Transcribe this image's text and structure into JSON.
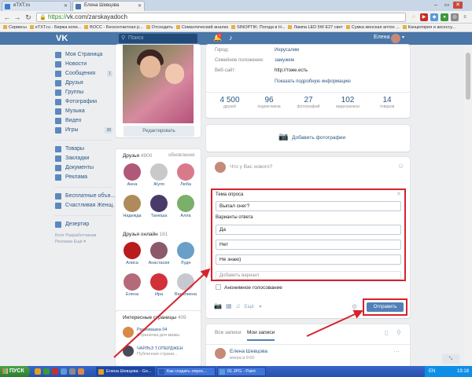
{
  "browser": {
    "tabs": [
      {
        "title": "eTXT.ru",
        "color": "#3a7bd5"
      },
      {
        "title": "Елена Шевцова",
        "color": "#4a76a8"
      }
    ],
    "url_scheme": "https://",
    "url_rest": "vk.com/zarskayadoch",
    "bookmarks": [
      "Сервисы",
      "eTXT.ru - Биржа копи...",
      "BOCC - Бесконтактная р...",
      "Отсоедить",
      "Семантический анализ",
      "SINOPTIK: Погода в Н...",
      "Лампа LED 5W E27 свет",
      "Сумка женская аптон ...",
      "Канцелярия и аксессу..."
    ]
  },
  "vk": {
    "logo": "VK",
    "search_placeholder": "Поиск",
    "notif_count": "1",
    "user_name": "Елена"
  },
  "nav": [
    {
      "label": "Моя Страница",
      "count": "",
      "color": "#5b88bd"
    },
    {
      "label": "Новости",
      "count": "",
      "color": "#5b88bd"
    },
    {
      "label": "Сообщения",
      "count": "1",
      "color": "#5b88bd"
    },
    {
      "label": "Друзья",
      "count": "",
      "color": "#5b88bd"
    },
    {
      "label": "Группы",
      "count": "",
      "color": "#5b88bd"
    },
    {
      "label": "Фотографии",
      "count": "",
      "color": "#5b88bd"
    },
    {
      "label": "Музыка",
      "count": "",
      "color": "#5b88bd"
    },
    {
      "label": "Видео",
      "count": "",
      "color": "#5b88bd"
    },
    {
      "label": "Игры",
      "count": "38",
      "color": "#5b88bd"
    }
  ],
  "nav2": [
    {
      "label": "Товары",
      "count": ""
    },
    {
      "label": "Закладки",
      "count": ""
    },
    {
      "label": "Документы",
      "count": ""
    },
    {
      "label": "Реклама",
      "count": ""
    }
  ],
  "nav3": [
    {
      "label": "Бесплатные объя...",
      "count": ""
    },
    {
      "label": "Счастливая Женщ...",
      "count": ""
    }
  ],
  "nav4": [
    {
      "label": "Дезертир",
      "count": ""
    }
  ],
  "footer": {
    "line1": "Блог   Разработчикам",
    "line2": "Реклама   Ещё ▾"
  },
  "profile": {
    "edit_label": "Редактировать",
    "info": [
      {
        "k": "Город:",
        "v": "Иерусалим",
        "plain": false
      },
      {
        "k": "Семейное положение:",
        "v": "замужем",
        "plain": false
      },
      {
        "k": "Веб-сайт:",
        "v": "http://тоже.есть",
        "plain": true
      }
    ],
    "more_info": "Показать подробную информацию",
    "counters": [
      {
        "num": "4 500",
        "lbl": "друзей"
      },
      {
        "num": "96",
        "lbl": "подписчиков"
      },
      {
        "num": "27",
        "lbl": "фотографий"
      },
      {
        "num": "102",
        "lbl": "видеозаписи"
      },
      {
        "num": "14",
        "lbl": "товаров"
      }
    ],
    "add_photo": "Добавить фотографии"
  },
  "friends": {
    "title": "Друзья",
    "count": "4900",
    "link": "обновления",
    "list": [
      {
        "name": "Анна",
        "color": "#b0577a"
      },
      {
        "name": "Жуля",
        "color": "#c9c9c9"
      },
      {
        "name": "Люба",
        "color": "#d97a8a"
      },
      {
        "name": "Надежда",
        "color": "#b08a5a"
      },
      {
        "name": "Танюша",
        "color": "#4a3a6a"
      },
      {
        "name": "Алла",
        "color": "#7ab06a"
      }
    ],
    "online_title": "Друзья онлайн",
    "online_count": "181",
    "online": [
      {
        "name": "Алиса",
        "color": "#b81c1c"
      },
      {
        "name": "Анастасия",
        "color": "#8a5a6a"
      },
      {
        "name": "Лудя",
        "color": "#6aa0c8"
      },
      {
        "name": "Елена",
        "color": "#b56a7a"
      },
      {
        "name": "Ира",
        "color": "#d2303a"
      },
      {
        "name": "Василиена",
        "color": "#c8c8d0"
      }
    ]
  },
  "interest": {
    "title": "Интересные страницы",
    "count": "409",
    "pages": [
      {
        "title": "Развевашка 04",
        "sub": "Страничка для мамы",
        "color": "#d88a4a"
      },
      {
        "title": "ЧАРЛЬЗ Т.ОПЕРДЖЕН",
        "sub": "Публичная страни...",
        "color": "#4a4a5a"
      }
    ]
  },
  "poster": {
    "placeholder": "Что у Вас нового?"
  },
  "poll": {
    "topic_label": "Тема опроса",
    "topic_value": "Выпал снег?",
    "answers_label": "Варианты ответа",
    "answers": [
      "Да",
      "Нет",
      "Не знаю)"
    ],
    "add_option": "Добавить вариант",
    "anonymous": "Анонимное голосование",
    "more": "Ещё",
    "send": "Отправить"
  },
  "wall": {
    "tab_all": "Все записи",
    "tab_mine": "Мои записи",
    "post_name": "Елена Шевцова",
    "post_time": "вчера в 9:00"
  },
  "zoom": "⤡",
  "taskbar": {
    "start": "ПУСК",
    "tasks": [
      {
        "title": "Елена Шевцова - Go...",
        "color": "#e0a020",
        "active": true
      },
      {
        "title": "Как создать опрос...",
        "color": "#2a5aa8",
        "active": false
      },
      {
        "title": "01.JPG - Paint",
        "color": "#5a9ad8",
        "active": false
      }
    ],
    "lang": "EN",
    "clock": "19:18"
  },
  "colors": {
    "vk_blue": "#4a76a8",
    "highlight_red": "#d6232c"
  }
}
